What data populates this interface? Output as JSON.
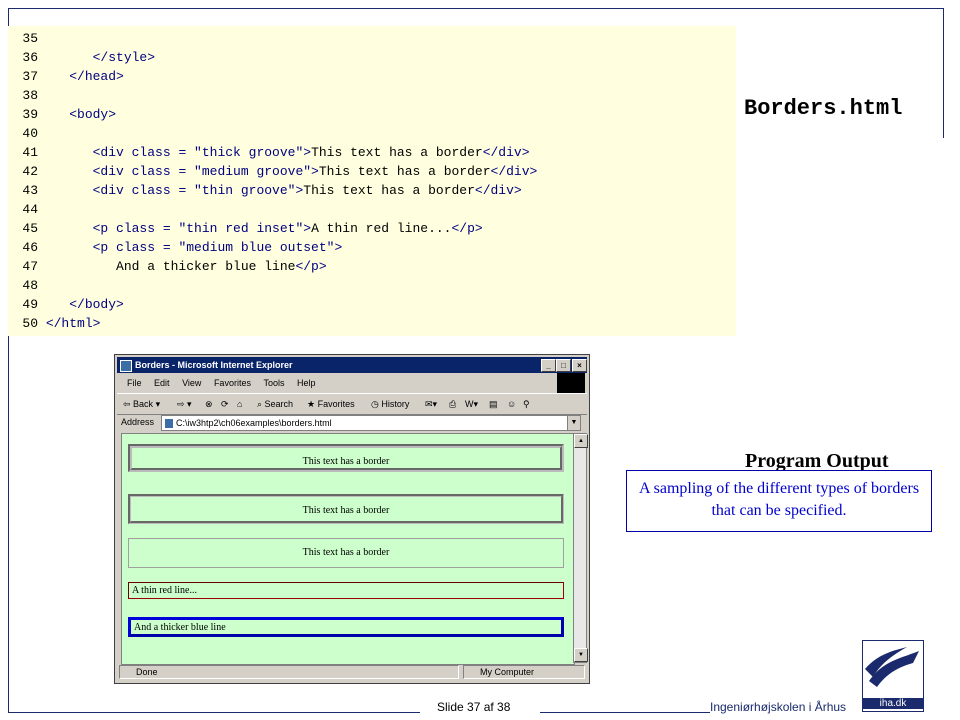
{
  "code": {
    "lines": [
      {
        "n": "35",
        "parts": []
      },
      {
        "n": "36",
        "parts": [
          {
            "t": "      ",
            "c": ""
          },
          {
            "t": "</style>",
            "c": "tag"
          }
        ]
      },
      {
        "n": "37",
        "parts": [
          {
            "t": "   ",
            "c": ""
          },
          {
            "t": "</head>",
            "c": "tag"
          }
        ]
      },
      {
        "n": "38",
        "parts": []
      },
      {
        "n": "39",
        "parts": [
          {
            "t": "   ",
            "c": ""
          },
          {
            "t": "<body>",
            "c": "tag"
          }
        ]
      },
      {
        "n": "40",
        "parts": []
      },
      {
        "n": "41",
        "parts": [
          {
            "t": "      ",
            "c": ""
          },
          {
            "t": "<div class = \"thick groove\">",
            "c": "tag"
          },
          {
            "t": "This text has a border",
            "c": ""
          },
          {
            "t": "</div>",
            "c": "tag"
          }
        ]
      },
      {
        "n": "42",
        "parts": [
          {
            "t": "      ",
            "c": ""
          },
          {
            "t": "<div class = \"medium groove\">",
            "c": "tag"
          },
          {
            "t": "This text has a border",
            "c": ""
          },
          {
            "t": "</div>",
            "c": "tag"
          }
        ]
      },
      {
        "n": "43",
        "parts": [
          {
            "t": "      ",
            "c": ""
          },
          {
            "t": "<div class = \"thin groove\">",
            "c": "tag"
          },
          {
            "t": "This text has a border",
            "c": ""
          },
          {
            "t": "</div>",
            "c": "tag"
          }
        ]
      },
      {
        "n": "44",
        "parts": []
      },
      {
        "n": "45",
        "parts": [
          {
            "t": "      ",
            "c": ""
          },
          {
            "t": "<p class = \"thin red inset\">",
            "c": "tag"
          },
          {
            "t": "A thin red line...",
            "c": ""
          },
          {
            "t": "</p>",
            "c": "tag"
          }
        ]
      },
      {
        "n": "46",
        "parts": [
          {
            "t": "      ",
            "c": ""
          },
          {
            "t": "<p class = \"medium blue outset\">",
            "c": "tag"
          }
        ]
      },
      {
        "n": "47",
        "parts": [
          {
            "t": "         And a thicker blue line",
            "c": ""
          },
          {
            "t": "</p>",
            "c": "tag"
          }
        ]
      },
      {
        "n": "48",
        "parts": []
      },
      {
        "n": "49",
        "parts": [
          {
            "t": "   ",
            "c": ""
          },
          {
            "t": "</body>",
            "c": "tag"
          }
        ]
      },
      {
        "n": "50",
        "parts": [
          {
            "t": "",
            "c": ""
          },
          {
            "t": "</html>",
            "c": "tag"
          }
        ]
      }
    ]
  },
  "slide": {
    "title": "Borders.html",
    "program_output": "Program Output",
    "callout": "A sampling of the different types of borders that can be specified.",
    "footer_slide": "Slide 37 af  38",
    "footer_school": "Ingeniørhøjskolen i Århus",
    "logo_text": "iha.dk"
  },
  "browser": {
    "title": "Borders - Microsoft Internet Explorer",
    "menu": [
      "File",
      "Edit",
      "View",
      "Favorites",
      "Tools",
      "Help"
    ],
    "toolbar": {
      "back": "Back",
      "search": "Search",
      "favorites": "Favorites",
      "history": "History"
    },
    "address_label": "Address",
    "address_value": "C:\\iw3htp2\\ch06examples\\borders.html",
    "status_done": "Done",
    "status_zone": "My Computer",
    "content": {
      "div1": "This text has a border",
      "div2": "This text has a border",
      "div3": "This text has a border",
      "p1": "A thin red line...",
      "p2": "And a thicker blue line"
    }
  }
}
